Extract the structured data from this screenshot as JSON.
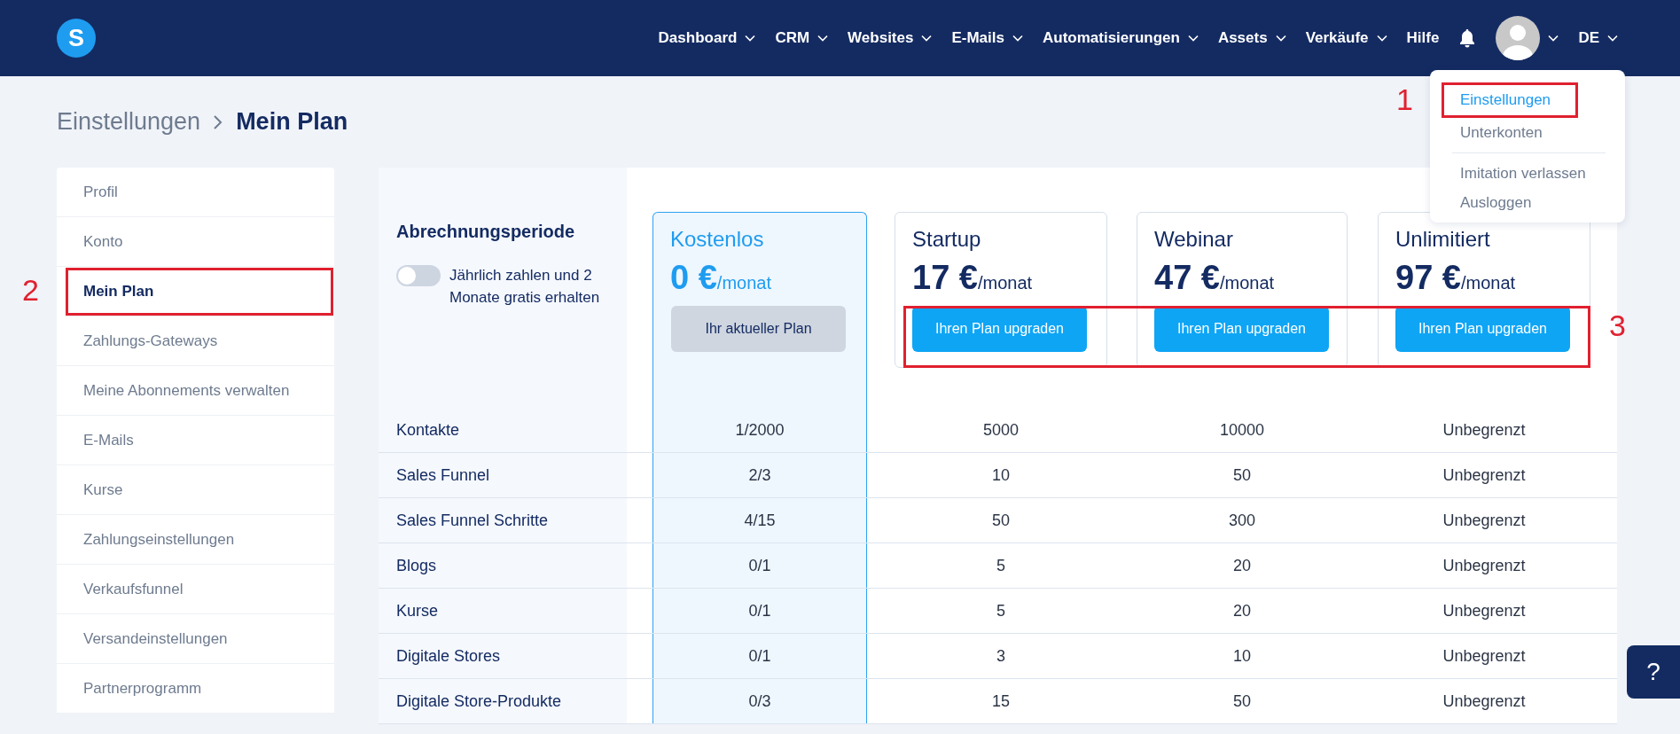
{
  "logo": {
    "text": "S"
  },
  "nav": [
    {
      "label": "Dashboard",
      "dropdown": true
    },
    {
      "label": "CRM",
      "dropdown": true
    },
    {
      "label": "Websites",
      "dropdown": true
    },
    {
      "label": "E-Mails",
      "dropdown": true
    },
    {
      "label": "Automatisierungen",
      "dropdown": true
    },
    {
      "label": "Assets",
      "dropdown": true
    },
    {
      "label": "Verkäufe",
      "dropdown": true
    },
    {
      "label": "Hilfe",
      "dropdown": false
    }
  ],
  "language": {
    "label": "DE"
  },
  "user_menu": {
    "groups": [
      {
        "items": [
          {
            "label": "Einstellungen",
            "selected": true,
            "annotation": "1"
          },
          {
            "label": "Unterkonten",
            "selected": false
          }
        ]
      },
      {
        "items": [
          {
            "label": "Imitation verlassen",
            "selected": false
          },
          {
            "label": "Ausloggen",
            "selected": false
          }
        ]
      }
    ]
  },
  "breadcrumb": [
    {
      "label": "Einstellungen",
      "current": false
    },
    {
      "label": "Mein Plan",
      "current": true
    }
  ],
  "sidebar": {
    "items": [
      {
        "label": "Profil",
        "selected": false
      },
      {
        "label": "Konto",
        "selected": false
      },
      {
        "label": "Mein Plan",
        "selected": true,
        "annotation": "2"
      },
      {
        "label": "Zahlungs-Gateways",
        "selected": false
      },
      {
        "label": "Meine Abonnements verwalten",
        "selected": false
      },
      {
        "label": "E-Mails",
        "selected": false
      },
      {
        "label": "Kurse",
        "selected": false
      },
      {
        "label": "Zahlungseinstellungen",
        "selected": false
      },
      {
        "label": "Verkaufsfunnel",
        "selected": false
      },
      {
        "label": "Versandeinstellungen",
        "selected": false
      },
      {
        "label": "Partnerprogramm",
        "selected": false
      }
    ]
  },
  "billing": {
    "title": "Abrechnungsperiode",
    "toggle": {
      "label": "Jährlich zahlen und 2 Monate gratis erhalten",
      "on": false
    }
  },
  "plans": [
    {
      "name": "Kostenlos",
      "price": "0 €",
      "period": "/monat",
      "button": "Ihr aktueller Plan",
      "current": true
    },
    {
      "name": "Startup",
      "price": "17 €",
      "period": "/monat",
      "button": "Ihren Plan upgraden",
      "current": false
    },
    {
      "name": "Webinar",
      "price": "47 €",
      "period": "/monat",
      "button": "Ihren Plan upgraden",
      "current": false
    },
    {
      "name": "Unlimitiert",
      "price": "97 €",
      "period": "/monat",
      "button": "Ihren Plan upgraden",
      "current": false
    }
  ],
  "upgrade_highlight": {
    "annotation": "3"
  },
  "rows": [
    {
      "label": "Kontakte",
      "values": [
        "1/2000",
        "5000",
        "10000",
        "Unbegrenzt"
      ]
    },
    {
      "label": "Sales Funnel",
      "values": [
        "2/3",
        "10",
        "50",
        "Unbegrenzt"
      ]
    },
    {
      "label": "Sales Funnel Schritte",
      "values": [
        "4/15",
        "50",
        "300",
        "Unbegrenzt"
      ]
    },
    {
      "label": "Blogs",
      "values": [
        "0/1",
        "5",
        "20",
        "Unbegrenzt"
      ]
    },
    {
      "label": "Kurse",
      "values": [
        "0/1",
        "5",
        "20",
        "Unbegrenzt"
      ]
    },
    {
      "label": "Digitale Stores",
      "values": [
        "0/1",
        "3",
        "10",
        "Unbegrenzt"
      ]
    },
    {
      "label": "Digitale Store-Produkte",
      "values": [
        "0/3",
        "15",
        "50",
        "Unbegrenzt"
      ]
    }
  ],
  "help": {
    "label": "?"
  }
}
